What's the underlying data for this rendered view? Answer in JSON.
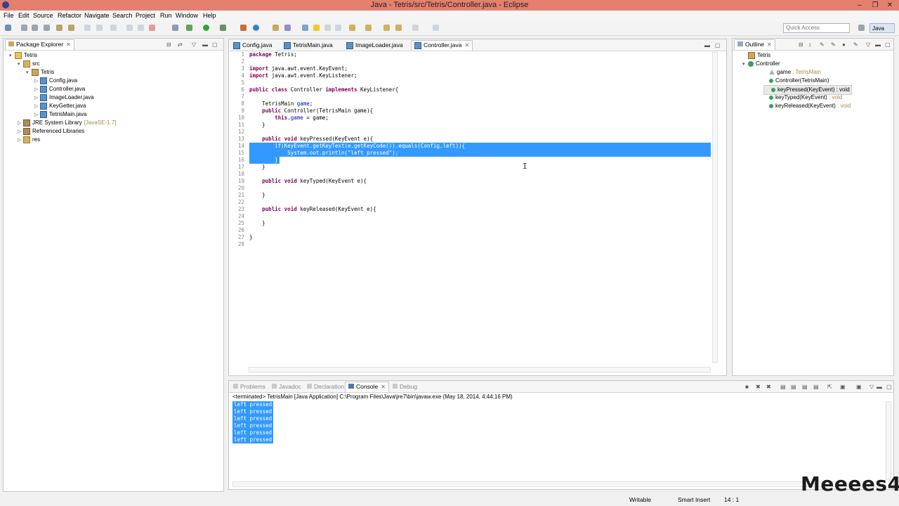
{
  "window": {
    "title": "Java - Tetris/src/Tetris/Controller.java - Eclipse"
  },
  "menu": [
    "File",
    "Edit",
    "Source",
    "Refactor",
    "Navigate",
    "Search",
    "Project",
    "Run",
    "Window",
    "Help"
  ],
  "toolbar": {
    "quick_access_placeholder": "Quick Access",
    "perspective": "Java"
  },
  "package_explorer": {
    "title": "Package Explorer",
    "tree": [
      {
        "label": "Tetris",
        "level": 0,
        "icon": "project-icon",
        "twisty": "▾"
      },
      {
        "label": "src",
        "level": 1,
        "icon": "folder-icon",
        "twisty": "▾"
      },
      {
        "label": "Tetris",
        "level": 2,
        "icon": "package-icon",
        "twisty": "▾"
      },
      {
        "label": "Config.java",
        "level": 3,
        "icon": "java-file-icon",
        "twisty": "▷"
      },
      {
        "label": "Controller.java",
        "level": 3,
        "icon": "java-file-icon",
        "twisty": "▷"
      },
      {
        "label": "ImageLoader.java",
        "level": 3,
        "icon": "java-file-icon",
        "twisty": "▷"
      },
      {
        "label": "KeyGetter.java",
        "level": 3,
        "icon": "java-file-icon",
        "twisty": "▷"
      },
      {
        "label": "TetrisMain.java",
        "level": 3,
        "icon": "java-file-icon",
        "twisty": "▷"
      },
      {
        "label": "JRE System Library",
        "suffix": "[JavaSE-1.7]",
        "level": 1,
        "icon": "library-icon",
        "twisty": "▷"
      },
      {
        "label": "Referenced Libraries",
        "level": 1,
        "icon": "library-icon",
        "twisty": "▷"
      },
      {
        "label": "res",
        "level": 1,
        "icon": "folder-icon",
        "twisty": "▷"
      }
    ]
  },
  "editor": {
    "tabs": [
      {
        "label": "Config.java",
        "active": false
      },
      {
        "label": "TetrisMain.java",
        "active": false
      },
      {
        "label": "ImageLoader.java",
        "active": false
      },
      {
        "label": "Controller.java",
        "active": true
      }
    ],
    "lines": [
      {
        "n": "1",
        "html": "<span class=\"kw\">package</span> Tetris;"
      },
      {
        "n": "2",
        "html": ""
      },
      {
        "n": "3",
        "html": "<span class=\"kw\">import</span> java.awt.event.KeyEvent;"
      },
      {
        "n": "4",
        "html": "<span class=\"kw\">import</span> java.awt.event.KeyListener;"
      },
      {
        "n": "5",
        "html": ""
      },
      {
        "n": "6",
        "html": "<span class=\"kw\">public class</span> Controller <span class=\"kw\">implements</span> KeyListener{"
      },
      {
        "n": "7",
        "html": ""
      },
      {
        "n": "8",
        "html": "    TetrisMain <span class=\"fld\">game</span>;"
      },
      {
        "n": "9",
        "html": "    <span class=\"kw\">public</span> Controller(TetrisMain game){"
      },
      {
        "n": "10",
        "html": "        <span class=\"kw\">this</span>.<span class=\"fld\">game</span> = game;"
      },
      {
        "n": "11",
        "html": "    }"
      },
      {
        "n": "12",
        "html": ""
      },
      {
        "n": "13",
        "html": "    <span class=\"kw\">public void</span> keyPressed(KeyEvent e){"
      },
      {
        "n": "14",
        "html": "        if(KeyEvent.getKeyText(e.getKeyCode()).equals(Config.left)){",
        "selected": true
      },
      {
        "n": "15",
        "html": "            System.out.println(\"left pressed\");",
        "selected": true
      },
      {
        "n": "16",
        "html": "        }",
        "selected": true,
        "partial": true
      },
      {
        "n": "17",
        "html": "    }"
      },
      {
        "n": "18",
        "html": ""
      },
      {
        "n": "19",
        "html": "    <span class=\"kw\">public void</span> keyTyped(KeyEvent e){"
      },
      {
        "n": "20",
        "html": ""
      },
      {
        "n": "21",
        "html": "    }"
      },
      {
        "n": "22",
        "html": ""
      },
      {
        "n": "23",
        "html": "    <span class=\"kw\">public void</span> keyReleased(KeyEvent e){"
      },
      {
        "n": "24",
        "html": ""
      },
      {
        "n": "25",
        "html": "    }"
      },
      {
        "n": "26",
        "html": ""
      },
      {
        "n": "27",
        "html": "}"
      },
      {
        "n": "28",
        "html": ""
      }
    ]
  },
  "outline": {
    "title": "Outline",
    "items": [
      {
        "label": "Tetris",
        "icon": "package-icon",
        "indent": 0
      },
      {
        "label": "Controller",
        "icon": "class-icon",
        "indent": 0,
        "twisty": "▾"
      },
      {
        "label": "game",
        "type": " : TetrisMain",
        "icon": "field-icon",
        "indent": 1
      },
      {
        "label": "Controller(TetrisMain)",
        "icon": "constructor-icon",
        "indent": 1
      },
      {
        "label": "keyPressed(KeyEvent) : void",
        "icon": "method-icon",
        "indent": 1,
        "selected": true
      },
      {
        "label": "keyTyped(KeyEvent)",
        "type": " : void",
        "icon": "method-icon",
        "indent": 1
      },
      {
        "label": "keyReleased(KeyEvent)",
        "type": " : void",
        "icon": "method-icon",
        "indent": 1
      }
    ]
  },
  "bottom": {
    "tabs": [
      {
        "label": "Problems",
        "active": false
      },
      {
        "label": "Javadoc",
        "active": false
      },
      {
        "label": "Declaration",
        "active": false
      },
      {
        "label": "Console",
        "active": true
      },
      {
        "label": "Debug",
        "active": false
      }
    ],
    "terminated": "<terminated> TetrisMain [Java Application] C:\\Program Files\\Java\\jre7\\bin\\javaw.exe (May 18, 2014, 4:44:16 PM)",
    "output": [
      "left pressed",
      "left pressed",
      "left pressed",
      "left pressed",
      "left pressed",
      "left pressed"
    ]
  },
  "status": {
    "writable": "Writable",
    "insert": "Smart Insert",
    "position": "14 : 1"
  },
  "watermark": "Meeees4"
}
